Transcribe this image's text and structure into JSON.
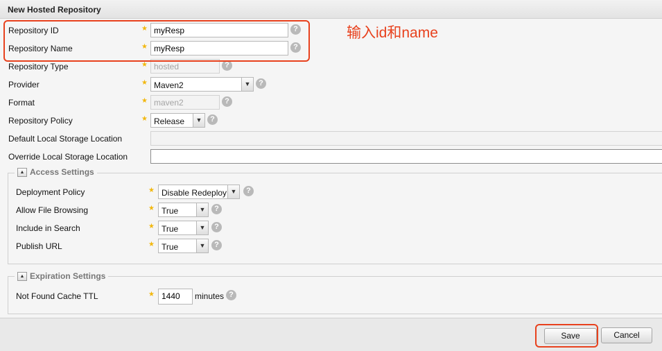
{
  "panel": {
    "title": "New Hosted Repository"
  },
  "annotation": {
    "text": "输入id和name",
    "color": "#e8411d"
  },
  "fields": {
    "repository_id": {
      "label": "Repository ID",
      "value": "myResp"
    },
    "repository_name": {
      "label": "Repository Name",
      "value": "myResp"
    },
    "repository_type": {
      "label": "Repository Type",
      "value": "hosted"
    },
    "provider": {
      "label": "Provider",
      "value": "Maven2"
    },
    "format": {
      "label": "Format",
      "value": "maven2"
    },
    "repository_policy": {
      "label": "Repository Policy",
      "value": "Release"
    },
    "default_storage": {
      "label": "Default Local Storage Location",
      "value": ""
    },
    "override_storage": {
      "label": "Override Local Storage Location",
      "value": ""
    }
  },
  "access_settings": {
    "title": "Access Settings",
    "deployment_policy": {
      "label": "Deployment Policy",
      "value": "Disable Redeploy"
    },
    "allow_file_browsing": {
      "label": "Allow File Browsing",
      "value": "True"
    },
    "include_in_search": {
      "label": "Include in Search",
      "value": "True"
    },
    "publish_url": {
      "label": "Publish URL",
      "value": "True"
    }
  },
  "expiration_settings": {
    "title": "Expiration Settings",
    "not_found_cache_ttl": {
      "label": "Not Found Cache TTL",
      "value": "1440",
      "unit": "minutes"
    }
  },
  "buttons": {
    "save": "Save",
    "cancel": "Cancel"
  },
  "icons": {
    "required": "star-icon",
    "help": "help-icon",
    "dropdown": "chevron-down-icon",
    "collapse": "collapse-icon"
  },
  "symbols": {
    "star": "★",
    "help": "?",
    "arrow": "▼",
    "collapse": "▲"
  }
}
